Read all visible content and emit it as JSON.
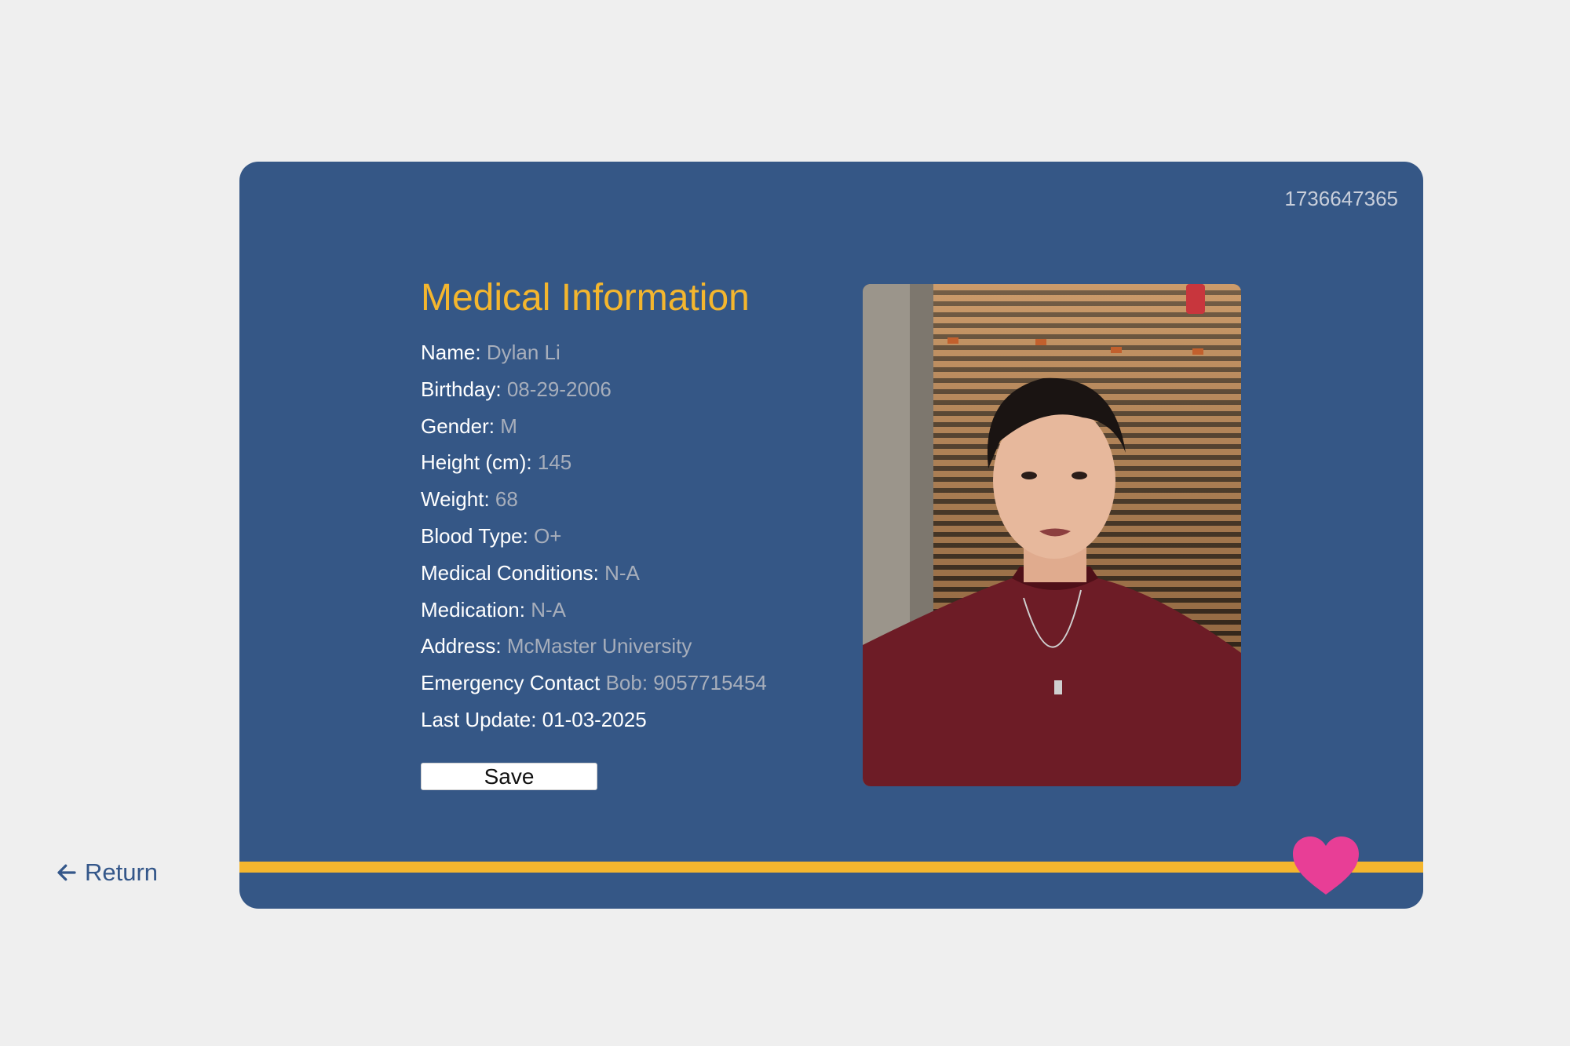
{
  "return_link": {
    "label": "Return"
  },
  "card": {
    "id_number": "1736647365"
  },
  "medical": {
    "title": "Medical Information",
    "fields": [
      {
        "label": "Name:",
        "value": "Dylan Li"
      },
      {
        "label": "Birthday:",
        "value": "08-29-2006"
      },
      {
        "label": "Gender:",
        "value": "M"
      },
      {
        "label": "Height (cm):",
        "value": "145"
      },
      {
        "label": "Weight:",
        "value": "68"
      },
      {
        "label": "Blood Type:",
        "value": "O+"
      },
      {
        "label": "Medical Conditions:",
        "value": "N-A"
      },
      {
        "label": "Medication:",
        "value": "N-A"
      },
      {
        "label": "Address:",
        "value": "McMaster University"
      },
      {
        "label": "Emergency Contact",
        "value": "Bob: 9057715454"
      }
    ],
    "last_update": "Last Update: 01-03-2025",
    "save_label": "Save"
  },
  "colors": {
    "card_bg": "#355786",
    "accent": "#f4b62e",
    "heart": "#e83e96",
    "value_text": "#a7aebb",
    "page_bg": "#efefef"
  },
  "icons": {
    "return": "arrow-left-icon",
    "favorite": "heart-icon"
  }
}
